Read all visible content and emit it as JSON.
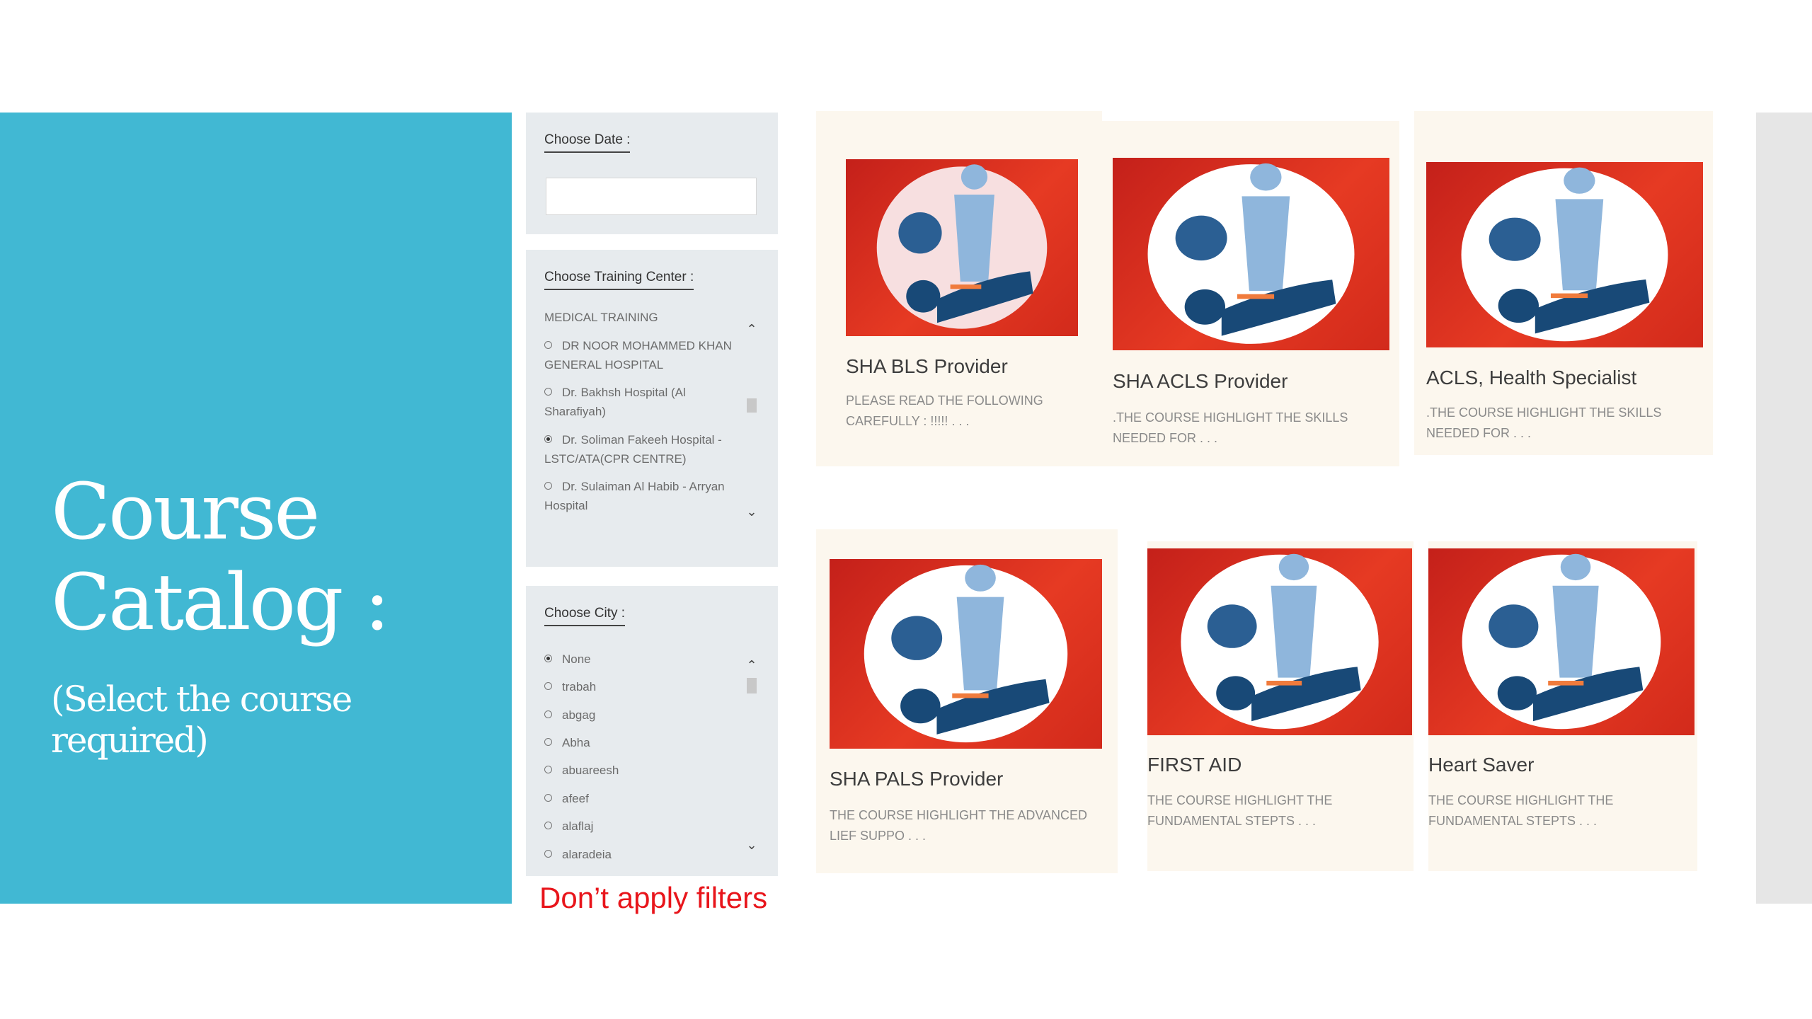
{
  "slide": {
    "title_line1": "Course",
    "title_line2": "Catalog :",
    "subtitle": "(Select the course required)",
    "annotation": "Don’t apply filters"
  },
  "filters": {
    "date_label": "Choose Date :",
    "date_value": "",
    "center_label": "Choose Training Center :",
    "centers": [
      {
        "label": "MEDICAL TRAINING",
        "selected": false,
        "partial_above": true
      },
      {
        "label": "DR NOOR MOHAMMED KHAN GENERAL HOSPITAL",
        "selected": false
      },
      {
        "label": "Dr. Bakhsh Hospital (Al Sharafiyah)",
        "selected": false
      },
      {
        "label": "Dr. Soliman Fakeeh Hospital - LSTC/ATA(CPR CENTRE)",
        "selected": true
      },
      {
        "label": "Dr. Sulaiman Al Habib - Arryan Hospital",
        "selected": false
      }
    ],
    "city_label": "Choose City :",
    "cities": [
      {
        "label": "None",
        "selected": true
      },
      {
        "label": "trabah",
        "selected": false
      },
      {
        "label": "abgag",
        "selected": false
      },
      {
        "label": "Abha",
        "selected": false
      },
      {
        "label": "abuareesh",
        "selected": false
      },
      {
        "label": "afeef",
        "selected": false
      },
      {
        "label": "alaflaj",
        "selected": false
      },
      {
        "label": "alaradeia",
        "selected": false
      }
    ],
    "scroll_up_icon": "chevron-up-icon",
    "scroll_down_icon": "chevron-down-icon"
  },
  "courses": [
    {
      "title": "SHA BLS Provider",
      "desc": "PLEASE READ THE FOLLOWING CAREFULLY : !!!!! . . .",
      "image": "cpr-icon"
    },
    {
      "title": "SHA ACLS Provider",
      "desc": ".THE COURSE HIGHLIGHT THE SKILLS NEEDED FOR . . .",
      "image": "cpr-icon"
    },
    {
      "title": "ACLS, Health Specialist",
      "desc": ".THE COURSE HIGHLIGHT THE SKILLS NEEDED FOR . . .",
      "image": "cpr-icon"
    },
    {
      "title": "SHA PALS Provider",
      "desc": "THE COURSE HIGHLIGHT THE ADVANCED LIEF SUPPO . . .",
      "image": "cpr-icon"
    },
    {
      "title": "FIRST AID",
      "desc": "THE COURSE HIGHLIGHT THE FUNDAMENTAL STEPTS . . .",
      "image": "cpr-icon"
    },
    {
      "title": "Heart Saver",
      "desc": "THE COURSE HIGHLIGHT THE FUNDAMENTAL STEPTS . . .",
      "image": "cpr-icon"
    }
  ],
  "colors": {
    "title_panel": "#41b8d3",
    "card_bg": "#fcf7ee",
    "image_red": "#e63a23",
    "annotation_red": "#e8151b"
  }
}
